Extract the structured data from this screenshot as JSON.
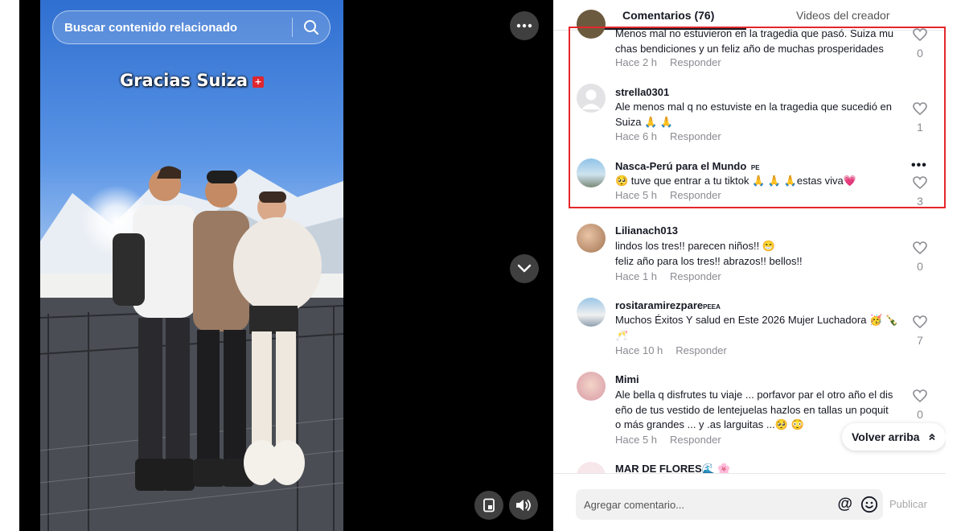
{
  "search": {
    "placeholder": "Buscar contenido relacionado"
  },
  "video": {
    "overlay_text": "Gracias Suiza",
    "flag": "+"
  },
  "tabs": {
    "comments": "Comentarios (76)",
    "videos": "Videos del creador"
  },
  "comments": [
    {
      "user": "",
      "lines": [
        "Menos mal no estuvieron en la tragedia que pasó. Suiza mu",
        "chas bendiciones y un feliz año de muchas prosperidades"
      ],
      "time": "Hace 2 h",
      "reply": "Responder",
      "likes": "0"
    },
    {
      "user": "strella0301",
      "lines": [
        "Ale menos mal q no estuviste en la tragedia que sucedió en",
        "Suiza 🙏 🙏"
      ],
      "time": "Hace 6 h",
      "reply": "Responder",
      "likes": "1"
    },
    {
      "user": "Nasca-Perú para el Mundo",
      "user_badge": "PE",
      "lines": [
        "🥺 tuve que entrar a tu tiktok 🙏 🙏 🙏estas viva💗"
      ],
      "time": "Hace 5 h",
      "reply": "Responder",
      "likes": "3"
    },
    {
      "user": "Lilianach013",
      "lines": [
        "lindos los tres!! parecen niños!! 😁",
        "feliz año para los tres!! abrazos!! bellos!!"
      ],
      "time": "Hace 1 h",
      "reply": "Responder",
      "likes": "0"
    },
    {
      "user": "rositaramirezpare",
      "user_badge": "PEEA",
      "lines": [
        "Muchos Éxitos Y salud en Este 2026 Mujer Luchadora 🥳 🍾",
        "🥂"
      ],
      "time": "Hace 10 h",
      "reply": "Responder",
      "likes": "7"
    },
    {
      "user": "Mimi",
      "lines": [
        "Ale bella q disfrutes tu viaje ... porfavor par el otro año el dis",
        "eño de tus vestido de lentejuelas hazlos en tallas un poquit",
        "o más grandes ... y .as larguitas ...🥺 😳"
      ],
      "time": "Hace 5 h",
      "reply": "Responder",
      "likes": "0"
    },
    {
      "user": "MAR DE FLORES🌊 🌸"
    }
  ],
  "scroll_top": {
    "label": "Volver arriba"
  },
  "composer": {
    "placeholder": "Agregar comentario...",
    "at_symbol": "@",
    "publish": "Publicar"
  },
  "icons": [
    "search-icon",
    "more-icon",
    "chevron-down-icon",
    "pip-icon",
    "volume-icon",
    "heart-icon",
    "emoji-icon",
    "chevron-up-icon"
  ],
  "colors": {
    "highlight": "#e4272b",
    "text": "#161823",
    "muted": "#8a8b91"
  }
}
